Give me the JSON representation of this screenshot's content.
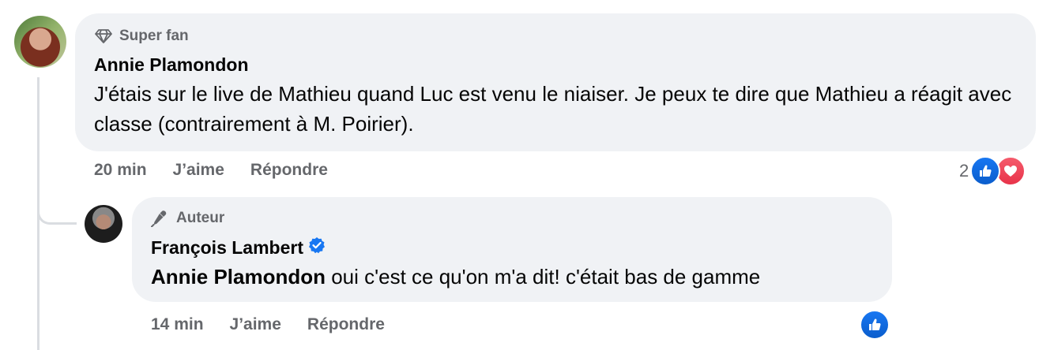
{
  "comment": {
    "badge": "Super fan",
    "author": "Annie Plamondon",
    "text": "J'étais sur le live de Mathieu quand Luc est venu le niaiser. Je peux te dire que Mathieu a réagit avec classe (contrairement à M. Poirier).",
    "time": "20 min",
    "like_label": "J’aime",
    "reply_label": "Répondre",
    "reaction_count": "2",
    "reactions": [
      "like-icon",
      "love-icon"
    ]
  },
  "reply": {
    "badge": "Auteur",
    "author": "François Lambert",
    "verified": true,
    "mention": "Annie Plamondon",
    "text": " oui c'est ce qu'on m'a dit! c'était bas de gamme",
    "time": "14 min",
    "like_label": "J’aime",
    "reply_label": "Répondre",
    "reactions": [
      "like-icon"
    ]
  },
  "colors": {
    "bubble": "#f0f2f5",
    "secondary_text": "#65676b",
    "like_blue": "#1877f2",
    "love_red": "#f33e58"
  }
}
